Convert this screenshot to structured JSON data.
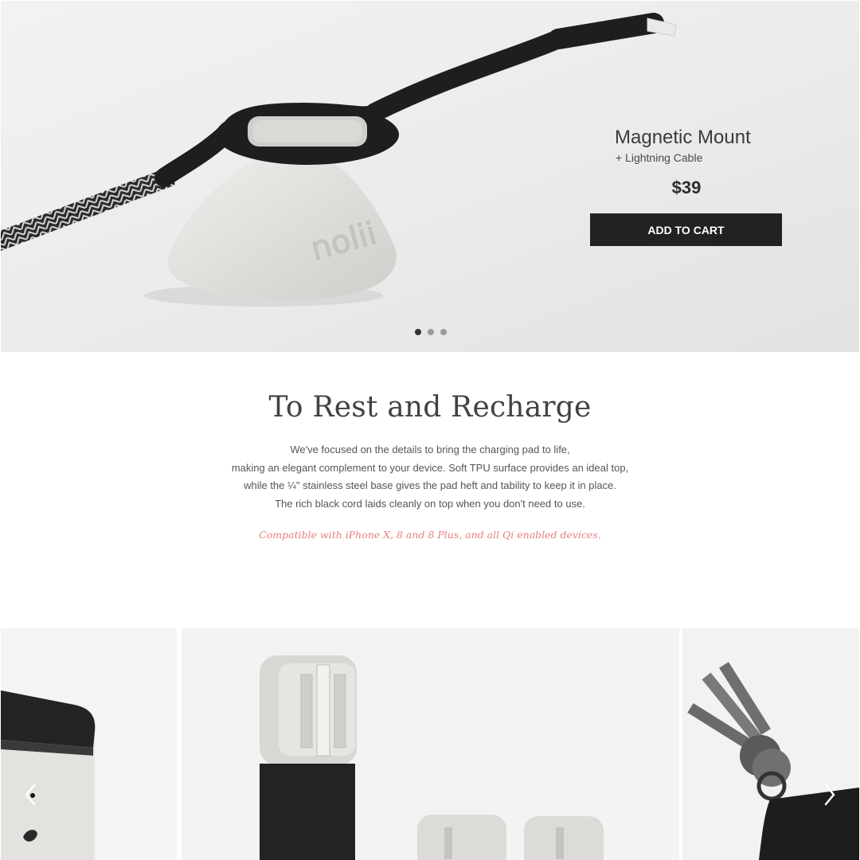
{
  "hero": {
    "product_title": "Magnetic Mount",
    "product_subtitle": "+ Lightning Cable",
    "price": "$39",
    "add_to_cart_label": "ADD TO CART",
    "brand_emboss": "nolii",
    "slide_count": 3,
    "active_slide": 1
  },
  "intro": {
    "heading": "To Rest and Recharge",
    "description_lines": [
      "We've focused on the details to bring the charging pad to life,",
      "making an elegant complement to your device. Soft TPU surface provides an ideal top,",
      "while the ¼\" stainless steel base gives the pad heft and tability to keep it in place.",
      "The rich black cord laids cleanly on top when you don't need to use."
    ],
    "compatibility": "Compatible with iPhone X, 8 and 8 Plus, and all Qi enabled devices."
  },
  "gallery": {
    "prev_icon": "chevron-left-icon",
    "next_icon": "chevron-right-icon",
    "tiles": [
      "charging-pad-closeup",
      "adapter-stick-products",
      "keys-keychain"
    ]
  },
  "colors": {
    "accent_pink": "#e87f7f",
    "button_dark": "#222222",
    "text_dark": "#424242"
  }
}
